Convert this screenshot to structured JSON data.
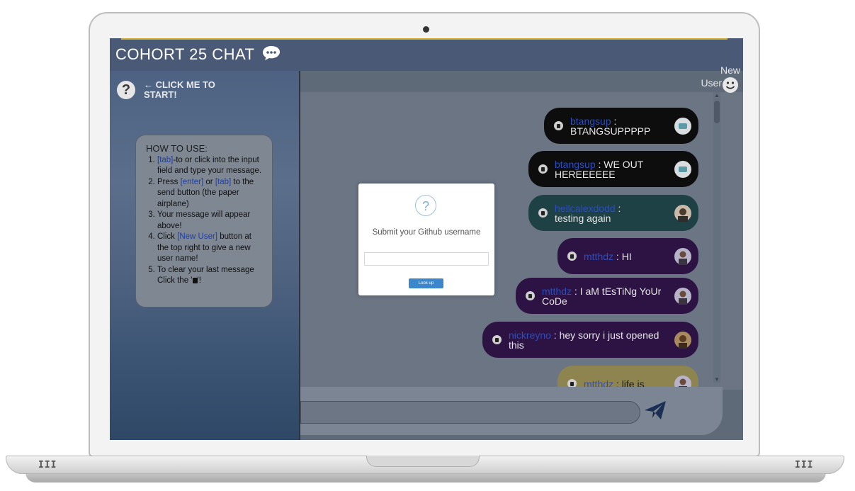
{
  "app": {
    "title": "COHORT 25 CHAT"
  },
  "sidebar": {
    "click_me": "← CLICK ME TO START!",
    "howto_title": "HOW TO USE:",
    "steps": [
      {
        "pre": "",
        "kw1": "[tab]",
        "mid": "-to or click into the input field and type your message.",
        "kw2": "",
        "post": ""
      },
      {
        "pre": "Press ",
        "kw1": "[enter]",
        "mid": " or ",
        "kw2": "[tab]",
        "post": " to the send button (the paper airplane)"
      },
      {
        "pre": "Your message will appear above!",
        "kw1": "",
        "mid": "",
        "kw2": "",
        "post": ""
      },
      {
        "pre": "Click ",
        "kw1": "[New User]",
        "mid": " button at the top right to give a new user name!",
        "kw2": "",
        "post": ""
      },
      {
        "pre": "To clear your last message Click the '",
        "kw1": "",
        "mid": "",
        "kw2": "",
        "post": "'!"
      }
    ]
  },
  "header": {
    "new_user_line1": "New",
    "new_user_line2": "User"
  },
  "messages": [
    {
      "user": "btangsup",
      "text": "BTANGSUPPPPP"
    },
    {
      "user": "btangsup",
      "text": "WE OUT HEREEEEEE"
    },
    {
      "user": "hellcalexdodd",
      "text": "testing again"
    },
    {
      "user": "mtthdz",
      "text": "HI"
    },
    {
      "user": "mtthdz",
      "text": "I aM tEsTiNg YoUr CoDe"
    },
    {
      "user": "nickreyno",
      "text": "hey sorry i just opened this"
    },
    {
      "user": "mtthdz",
      "text": "life is"
    }
  ],
  "modal": {
    "icon": "?",
    "title": "Submit your Github username",
    "input_value": "",
    "button_label": "Look up"
  },
  "colors": {
    "header_bg": "#4a5a76",
    "chat_bg": "#6b7584",
    "bubble_black": "#0d0d0d",
    "bubble_teal": "#1d4144",
    "bubble_purple": "#2c1343",
    "bubble_yellow": "#8e8450",
    "username_link": "#2a4dc2",
    "modal_button": "#3c86cc"
  }
}
